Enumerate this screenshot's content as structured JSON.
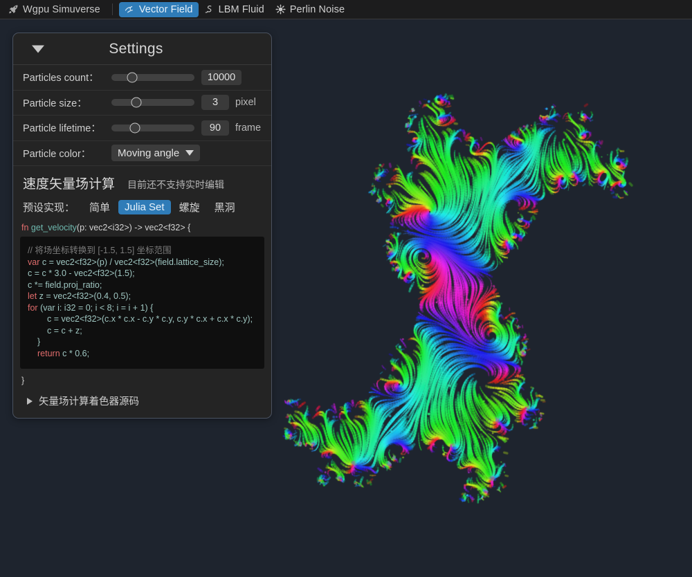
{
  "menubar": {
    "brand": {
      "label": "Wgpu Simuverse",
      "icon": "rocket-icon"
    },
    "tabs": [
      {
        "id": "vector-field",
        "label": "Vector Field",
        "icon": "vector-field-icon",
        "active": true
      },
      {
        "id": "lbm-fluid",
        "label": "LBM Fluid",
        "icon": "fluid-swirl-icon",
        "active": false
      },
      {
        "id": "perlin-noise",
        "label": "Perlin Noise",
        "icon": "noise-burst-icon",
        "active": false
      }
    ]
  },
  "panel": {
    "title": "Settings",
    "collapse_icon": "triangle-down-icon",
    "rows": [
      {
        "label": "Particles count：",
        "slider_pct": 25,
        "value": "10000",
        "unit": ""
      },
      {
        "label": "Particle size：",
        "slider_pct": 30,
        "value": "3",
        "unit": "pixel"
      },
      {
        "label": "Particle lifetime：",
        "slider_pct": 28,
        "value": "90",
        "unit": "frame"
      }
    ],
    "color_row": {
      "label": "Particle color：",
      "selected": "Moving angle",
      "caret_icon": "chevron-down-icon"
    },
    "section": {
      "title": "速度矢量场计算",
      "note": "目前还不支持实时编辑",
      "preset_label": "预设实现：",
      "presets": [
        {
          "label": "简单",
          "active": false
        },
        {
          "label": "Julia Set",
          "active": true
        },
        {
          "label": "螺旋",
          "active": false
        },
        {
          "label": "黑洞",
          "active": false
        }
      ]
    },
    "code": {
      "signature": {
        "kw": "fn",
        "name": " get_velocity",
        "rest": "(p: vec2<i32>) -> vec2<f32> {"
      },
      "lines": [
        {
          "indent": 0,
          "kind": "comment",
          "text": "// 将场坐标转换到 [-1.5, 1.5] 坐标范围"
        },
        {
          "indent": 0,
          "kind": "code",
          "kw": "var",
          "text": " c = vec2<f32>(p) / vec2<f32>(field.lattice_size);"
        },
        {
          "indent": 0,
          "kind": "plain",
          "text": "c = c * 3.0 - vec2<f32>(1.5);"
        },
        {
          "indent": 0,
          "kind": "plain",
          "text": "c *= field.proj_ratio;"
        },
        {
          "indent": 0,
          "kind": "code",
          "kw": "let",
          "text": " z = vec2<f32>(0.4, 0.5);"
        },
        {
          "indent": 0,
          "kind": "code",
          "kw": "for",
          "text": " (var i: i32 = 0; i < 8; i = i + 1) {"
        },
        {
          "indent": 1,
          "kind": "plain",
          "text": "c = vec2<f32>(c.x * c.x - c.y * c.y, c.y * c.x + c.x * c.y);"
        },
        {
          "indent": 1,
          "kind": "plain",
          "text": "c = c + z;"
        },
        {
          "indent": 0,
          "kind": "plain",
          "text": "}"
        },
        {
          "indent": 0,
          "kind": "code",
          "kw": "return",
          "text": " c * 0.6;"
        }
      ],
      "tail": "}"
    },
    "disclosure": {
      "icon": "triangle-right-icon",
      "label": "矢量场计算着色器源码"
    }
  },
  "viz": {
    "name": "vector-field-particle-canvas",
    "background": "#1e242e",
    "accent": "#2f7cb8",
    "description": "Julia Set velocity vector field rendered as colored particle streaks"
  }
}
